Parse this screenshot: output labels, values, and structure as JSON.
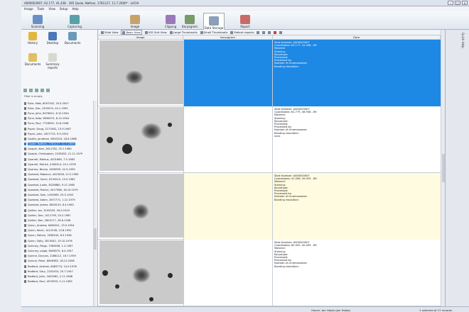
{
  "window": {
    "title": "A000003907, 62.177, 41.438 - 365 Quale, Nathan, 1781127, 11.7.2000* - LUCIA"
  },
  "menu": [
    "Image",
    "Tools",
    "View",
    "Setup",
    "Help"
  ],
  "ribbon": {
    "buttons": [
      {
        "label": "Scanning",
        "icon": "scanning-icon",
        "color": "#6a8fc7"
      },
      {
        "label": "Capturing",
        "icon": "capturing-icon",
        "color": "#5aa0a8"
      },
      {
        "label": "Image",
        "icon": "image-icon",
        "color": "#c7a36a"
      },
      {
        "label": "Clipping",
        "icon": "clipping-icon",
        "color": "#9a7ab8"
      },
      {
        "label": "Karyogram",
        "icon": "karyogram-icon",
        "color": "#7a9a6a"
      },
      {
        "label": "Data Storage",
        "icon": "database-icon",
        "color": "#8aa0b8"
      },
      {
        "label": "Report",
        "icon": "report-icon",
        "color": "#c86a6a"
      }
    ]
  },
  "left_panel": {
    "apps": [
      {
        "label": "History",
        "icon": "history-icon"
      },
      {
        "label": "Desktop",
        "icon": "desktop-icon"
      },
      {
        "label": "Documents",
        "icon": "documents-icon"
      },
      {
        "label": "Documents",
        "icon": "documents-folder-icon"
      },
      {
        "label": "Summary reports",
        "icon": "summary-reports-icon"
      }
    ],
    "filter_label": "Filter is empty.",
    "patients": [
      "Pyke, Matt, 8097342, 20.4.2007",
      "Pyke, Zoe, 1303474, 20.1.1995",
      "Pyne, John, 8079821, 6.10.1944",
      "Pyne, Kate, 8098274, 8.10.1944",
      "Pyne, Paul, 7726590, 15.8.1946",
      "Pyper, Doug, 2271842, 13.9.1967",
      "Pyper, John, 1827715, 9.5.1953",
      "Quaife, Jonathan, 9610524, 18.6.1988",
      "Quale, Nathan, 1781127, 11.7.2000",
      "Quaple, Alex, 2612782, 25.1.1960",
      "Quaple, Christopher, 2235633, 21.11.1979",
      "Quarrell, Markus, 4201669, 7.5.1983",
      "Quarrell, Patrick, 4180414, 24.1.1978",
      "Quarrey, Nicola, 1628999, 22.5.1959",
      "Quested, Rebecca, 4423528, 12.5.1963",
      "Quested, Gavin, 6154510, 15.5.1982",
      "Quested, Justin, 8228880, 9.12.1980",
      "Quested, Patrick, 4017586, 18.10.1979",
      "Quested, Sam, 1430969, 25.5.1943",
      "Quested, Adam, 2671771, 1.12.1979",
      "Quested, James, 8818153, 8.4.1963",
      "Quilter, Ian, 3195529, 18.5.1929",
      "Quilter, Dan, 1411795, 20.2.1967",
      "Quilter, Ben, 2825177, 28.6.1936",
      "Quinn, Andrew, 6480241, 13.5.1954",
      "Quinn, Kevin, 1412538, 15.8.1952",
      "Quinn, Patrick, 7838240, 8.9.1936",
      "Quinn, Sally, 2874542, 19.10.1976",
      "Quinney, Paige, 7585658, 1.2.1967",
      "Quinney, paige, 8098575, 8.4.1957",
      "Quinne, Duncan, 2286112, 16.7.1959",
      "Quinne, Peter, 8658385, 18.12.2006",
      "Radford, Andrew, 8483774, 14.9.1978",
      "Radford, Gary, 2202453, 20.7.1947",
      "Radford, John, 3453062, 2.11.1968",
      "Radford, Paul, 1673959, 5.11.1963"
    ]
  },
  "toolbar2": {
    "items": [
      "Slide View",
      "Basic View",
      "IGS Grid View",
      "Large Thumbnails",
      "Small Thumbnails",
      "Patient reports"
    ]
  },
  "table": {
    "columns": [
      "Image",
      "Karyogram",
      "Data"
    ],
    "records": [
      {
        "lines": [
          "Slide Number: A000003907",
          "Coordinates: 62.177, 41.438 - B9",
          "Material:",
          "Staining:",
          "Karyotype:",
          "Processed:",
          "Processed by:",
          "Number of chromosomes:",
          "Banding resolution:"
        ]
      },
      {
        "lines": [
          "Slide Number: A000003907",
          "Coordinates: 62.779, 46.938 - B9",
          "Material:",
          "Staining:",
          "Karyotype:",
          "Processed:",
          "Processed by:",
          "Number of chromosomes:",
          "Banding resolution:",
          "xxxx"
        ]
      },
      {
        "lines": [
          "Slide Number: A000003907",
          "Coordinates: 41.096, 39.929 - B9",
          "Material:",
          "Staining:",
          "Karyotype:",
          "Processed:",
          "Processed by:",
          "Number of chromosomes:",
          "Banding resolution:"
        ]
      },
      {
        "lines": [
          "Slide Number: A000003907",
          "Coordinates: 80.455, 40.499 - B9",
          "Material:",
          "Staining:",
          "Karyotype:",
          "Processed:",
          "Processed by:",
          "Number of chromosomes:",
          "Banding resolution:"
        ]
      }
    ]
  },
  "side_panel_label": "Quick Help",
  "status": {
    "owner": "Owner: Jan Hejda (Jan Hejda)",
    "count": "1 selected of 27 records"
  }
}
